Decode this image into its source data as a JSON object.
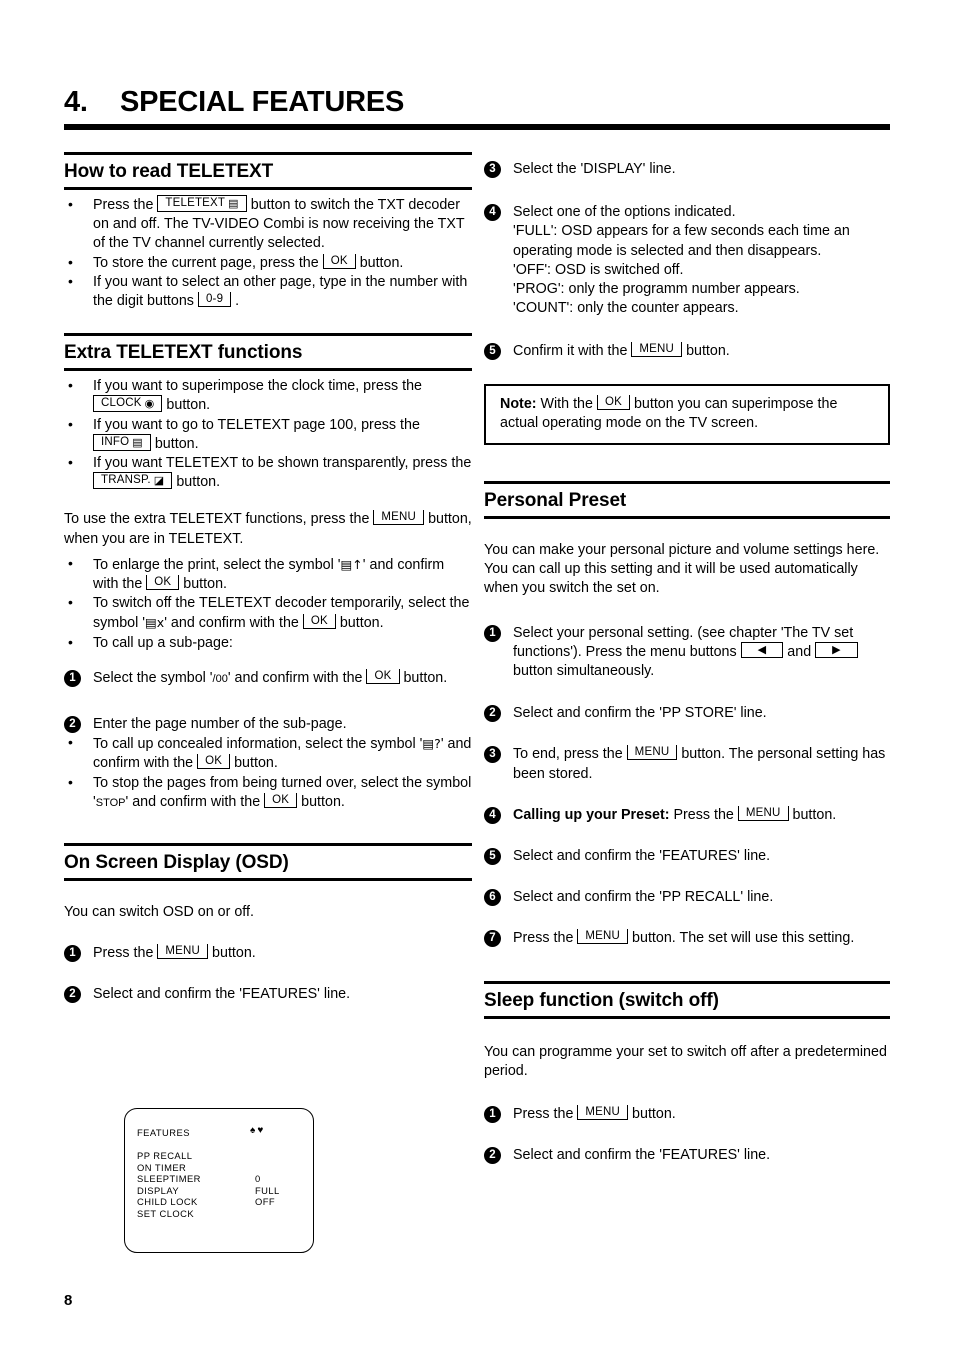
{
  "chapter": {
    "number": "4.",
    "title": "SPECIAL FEATURES"
  },
  "page_number": "8",
  "keys": {
    "teletext": "TELETEXT",
    "ok": "OK",
    "digits": "0-9",
    "clock": "CLOCK",
    "info": "INFO",
    "transp": "TRANSP.",
    "menu": "MENU",
    "left_arrow": "◀",
    "right_arrow": "▶"
  },
  "left_column": {
    "section1": {
      "heading": "How to read TELETEXT",
      "bullets": [
        {
          "pre": "Press the",
          "key": "TELETEXT",
          "key_glyph": "teletext-icon",
          "post": "button to switch the TXT decoder on and off. The TV-VIDEO Combi is now receiving the TXT of the TV channel currently selected."
        },
        {
          "pre": "To store the current page, press the",
          "key": "OK",
          "post": "button."
        },
        {
          "pre": "If you want to select an other page, type in the number with the digit buttons",
          "key": "0-9",
          "post": "."
        }
      ]
    },
    "section2": {
      "heading": "Extra TELETEXT functions",
      "bullets": [
        {
          "pre": "If you want to superimpose the clock time, press the",
          "key": "CLOCK",
          "key_glyph": "clock-icon",
          "post": "button."
        },
        {
          "pre": "If you want to go to TELETEXT page 100, press the",
          "key": "INFO",
          "key_glyph": "info-icon",
          "post": "button."
        },
        {
          "pre": "If you want TELETEXT to be shown transparently, press the",
          "key": "TRANSP.",
          "key_glyph": "transparent-icon",
          "post": "button."
        }
      ],
      "intro_pre": "To use the extra TELETEXT functions, press the",
      "intro_key": "MENU",
      "intro_post": "button, when you are in TELETEXT.",
      "bullets2": [
        {
          "pre": "To enlarge the print, select the symbol '",
          "symbol": "▤↑",
          "mid": "' and confirm with the",
          "key": "OK",
          "post": "button."
        },
        {
          "pre": "To switch off the TELETEXT decoder temporarily, select the symbol '",
          "symbol": "▤x",
          "mid": "' and confirm with the",
          "key": "OK",
          "post": "button."
        },
        {
          "pre": "To call up a sub-page:",
          "symbol": "",
          "mid": "",
          "key": "",
          "post": ""
        }
      ],
      "steps": [
        {
          "num": "1",
          "pre": "Select the symbol '",
          "symbol": "/00",
          "mid": "' and confirm with the",
          "key": "OK",
          "post": "button."
        },
        {
          "num": "2",
          "pre": "Enter the page number of the sub-page.",
          "symbol": "",
          "mid": "",
          "key": "",
          "post": ""
        }
      ],
      "bullets3": [
        {
          "pre": "To call up concealed information, select the symbol '",
          "symbol": "▤?",
          "mid": "' and confirm with the",
          "key": "OK",
          "post": "button."
        },
        {
          "pre": "To stop the pages from being turned over, select the symbol '",
          "symbol": "STOP",
          "mid": "' and confirm with the",
          "key": "OK",
          "post": "button."
        }
      ]
    },
    "section3": {
      "heading": "On Screen Display (OSD)",
      "intro": "You can switch OSD on or off.",
      "steps": [
        {
          "num": "1",
          "pre": "Press the",
          "key": "MENU",
          "post": "button."
        },
        {
          "num": "2",
          "pre": "Select and confirm the 'FEATURES' line.",
          "key": "",
          "post": ""
        }
      ]
    }
  },
  "tv_screen": {
    "title": "FEATURES",
    "marks": "♠♥",
    "rows": [
      {
        "label": "PP RECALL",
        "value": ""
      },
      {
        "label": "ON TIMER",
        "value": ""
      },
      {
        "label": "SLEEPTIMER",
        "value": "0"
      },
      {
        "label": "DISPLAY",
        "value": "FULL"
      },
      {
        "label": "CHILD LOCK",
        "value": "OFF"
      },
      {
        "label": "SET CLOCK",
        "value": ""
      }
    ]
  },
  "right_column": {
    "osd_steps": [
      {
        "num": "3",
        "text": "Select the 'DISPLAY' line."
      },
      {
        "num": "4",
        "text": "Select one of the options indicated.",
        "lines": [
          "'FULL': OSD appears for a few seconds each time an",
          "operating mode is selected and then disappears.",
          "'OFF': OSD is switched off.",
          "'PROG': only the programm number appears.",
          "'COUNT': only the counter appears."
        ]
      },
      {
        "num": "5",
        "pre": "Confirm it with the",
        "key": "MENU",
        "post": "button."
      }
    ],
    "note": {
      "label": "Note:",
      "pre": "With the",
      "key": "OK",
      "post": "button you can superimpose the actual operating mode on the TV screen."
    },
    "section_preset": {
      "heading": "Personal Preset",
      "intro": "You can make your personal picture and volume settings here. You can call up this setting and it will be used automatically when you switch the set on.",
      "steps": [
        {
          "num": "1",
          "pre": "Select your personal setting. (see chapter 'The TV set functions'). Press the menu buttons",
          "key_left": "◀",
          "mid": "and",
          "key_right": "▶",
          "post": "button simultaneously."
        },
        {
          "num": "2",
          "text": "Select and confirm the 'PP STORE' line."
        },
        {
          "num": "3",
          "pre": "To end, press the",
          "key": "MENU",
          "post": "button. The personal setting has been stored."
        },
        {
          "num": "4",
          "bold": "Calling up your Preset:",
          "pre": "Press the",
          "key": "MENU",
          "post": "button."
        },
        {
          "num": "5",
          "text": "Select and confirm the 'FEATURES' line."
        },
        {
          "num": "6",
          "text": "Select and confirm the 'PP RECALL' line."
        },
        {
          "num": "7",
          "pre": "Press the",
          "key": "MENU",
          "post": "button. The set will use this setting."
        }
      ]
    },
    "section_sleep": {
      "heading": "Sleep function (switch off)",
      "intro": "You can programme your set to switch off after a predetermined period.",
      "steps": [
        {
          "num": "1",
          "pre": "Press the",
          "key": "MENU",
          "post": "button."
        },
        {
          "num": "2",
          "text": "Select and confirm the 'FEATURES' line."
        }
      ]
    }
  }
}
